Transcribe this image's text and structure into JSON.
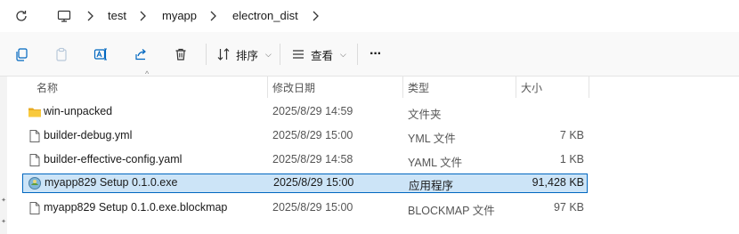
{
  "address_bar": {
    "breadcrumbs": [
      "test",
      "myapp",
      "electron_dist"
    ]
  },
  "toolbar": {
    "sort_label": "排序",
    "view_label": "查看",
    "more_label": "···"
  },
  "columns": {
    "name": "名称",
    "modified": "修改日期",
    "type": "类型",
    "size": "大小"
  },
  "files": [
    {
      "name": "win-unpacked",
      "modified": "2025/8/29 14:59",
      "type": "文件夹",
      "size": "",
      "icon": "folder-icon"
    },
    {
      "name": "builder-debug.yml",
      "modified": "2025/8/29 15:00",
      "type": "YML 文件",
      "size": "7 KB",
      "icon": "file-icon"
    },
    {
      "name": "builder-effective-config.yaml",
      "modified": "2025/8/29 14:58",
      "type": "YAML 文件",
      "size": "1 KB",
      "icon": "file-icon"
    },
    {
      "name": "myapp829 Setup 0.1.0.exe",
      "modified": "2025/8/29 15:00",
      "type": "应用程序",
      "size": "91,428 KB",
      "icon": "installer-icon",
      "selected": true
    },
    {
      "name": "myapp829 Setup 0.1.0.exe.blockmap",
      "modified": "2025/8/29 15:00",
      "type": "BLOCKMAP 文件",
      "size": "97 KB",
      "icon": "file-icon"
    }
  ],
  "colors": {
    "selection_bg": "#cce4f7",
    "selection_border": "#0067c0",
    "folder": "#f4c542"
  }
}
